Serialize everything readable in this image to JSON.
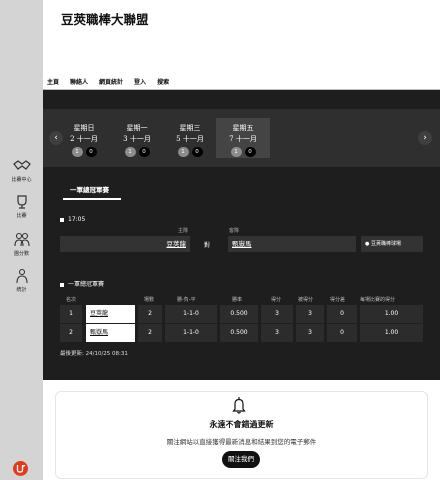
{
  "site": {
    "title": "豆莢職棒大聯盟"
  },
  "nav": [
    "主頁",
    "聯絡人",
    "網頁統計",
    "登入",
    "搜索"
  ],
  "sidebar": {
    "items": [
      {
        "label": "比賽中心",
        "icon": "handshake-icon"
      },
      {
        "label": "比賽",
        "icon": "trophy-icon"
      },
      {
        "label": "團分數",
        "icon": "team-icon"
      },
      {
        "label": "統計",
        "icon": "stats-icon"
      }
    ]
  },
  "schedule": {
    "prev_icon": "‹",
    "next_icon": "›",
    "days": [
      {
        "weekday": "星期日",
        "date": "2 十一月",
        "games": "1",
        "other": "0"
      },
      {
        "weekday": "星期一",
        "date": "3 十一月",
        "games": "1",
        "other": "0"
      },
      {
        "weekday": "星期三",
        "date": "5 十一月",
        "games": "1",
        "other": "0"
      },
      {
        "weekday": "星期五",
        "date": "7 十一月",
        "games": "1",
        "other": "0"
      }
    ],
    "tab": "一軍總冠軍賽"
  },
  "game": {
    "time": "17:05",
    "home_label": "主隊",
    "away_label": "客隊",
    "home_team": "豆莢龍",
    "away_team": "甄嶽馬",
    "vs": "對",
    "venue": "豆莢職棒球場"
  },
  "standings": {
    "title": "一軍總冠軍賽",
    "headers": [
      "名次",
      "場數",
      "勝-負-平",
      "勝率",
      "得分",
      "被得分",
      "得分差",
      "每場比賽的得分"
    ],
    "rows": [
      {
        "rank": "1",
        "team": "豆莢龍",
        "games": "2",
        "record": "1-1-0",
        "pct": "0.500",
        "runs": "3",
        "allowed": "3",
        "diff": "0",
        "per_game": "1.00"
      },
      {
        "rank": "2",
        "team": "甄嶽馬",
        "games": "2",
        "record": "1-1-0",
        "pct": "0.500",
        "runs": "3",
        "allowed": "3",
        "diff": "0",
        "per_game": "1.00"
      }
    ],
    "updated": "最後更新: 24/10/25 08:31"
  },
  "subscribe": {
    "title": "永遠不會錯過更新",
    "description": "關注網站以直接獲得最新消息和結果到您的電子郵件",
    "button": "關注我們"
  }
}
